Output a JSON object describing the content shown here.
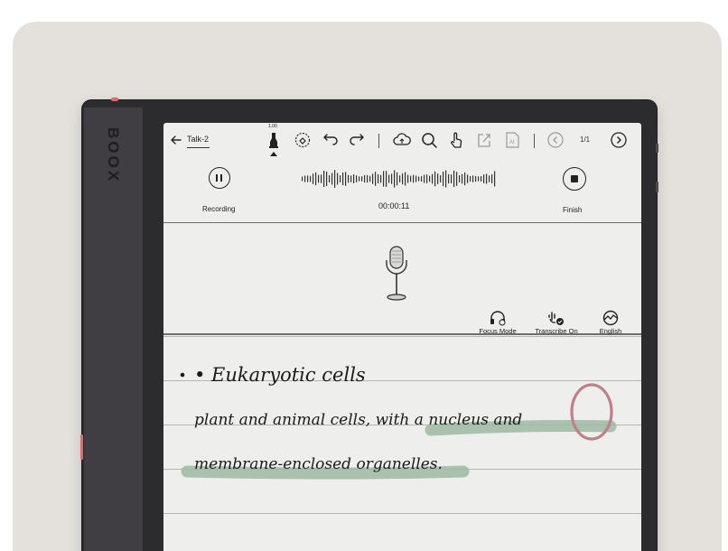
{
  "device": {
    "brand": "BOOX"
  },
  "toolbar": {
    "title": "Talk-2",
    "pen_size": "1.00",
    "page_indicator": "1/1",
    "icons": [
      "back-arrow",
      "pen",
      "eraser",
      "undo",
      "redo",
      "cloud-sync",
      "search",
      "touch",
      "share",
      "ai",
      "prev-page",
      "next-page"
    ]
  },
  "recording": {
    "pause_label": "Recording",
    "timer": "00:00:11",
    "finish_label": "Finish"
  },
  "mic_panel": {
    "options": [
      {
        "label": "Focus Mode",
        "icon": "headset-icon"
      },
      {
        "label": "Transcribe On",
        "icon": "transcribe-icon"
      },
      {
        "label": "English",
        "icon": "globe-icon"
      }
    ]
  },
  "notes": {
    "handwriting": [
      "• Eukaryotic cells",
      "plant and animal cells, with a nucleus and",
      "membrane-enclosed organelles."
    ],
    "highlight_color": "#9cb8a3",
    "circle_color": "#c0808a"
  },
  "colors": {
    "screen": "#eeeeec",
    "bezel": "#2c2b2e",
    "backdrop": "#e4e1dd"
  }
}
